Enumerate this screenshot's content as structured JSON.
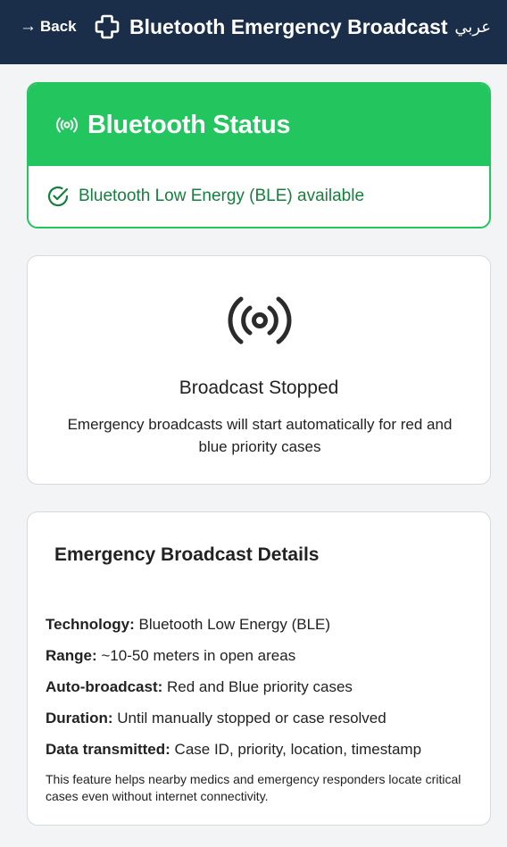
{
  "header": {
    "back_label": "Back",
    "back_arrow": "→",
    "title": "Bluetooth Emergency Broadcast",
    "language_toggle": "عربي",
    "background": "#1a2e4a"
  },
  "bluetooth_status": {
    "title": "Bluetooth Status",
    "status_text": "Bluetooth Low Energy (BLE) available",
    "header_color": "#22c55e",
    "text_color": "#15803d",
    "header_icon": "signal-broadcast-icon",
    "status_icon": "check-circle-icon"
  },
  "broadcast": {
    "icon": "broadcast-icon",
    "status": "Broadcast Stopped",
    "description": "Emergency broadcasts will start automatically for red and blue priority cases"
  },
  "details": {
    "title": "Emergency Broadcast Details",
    "rows": [
      {
        "label": "Technology:",
        "value": "Bluetooth Low Energy (BLE)"
      },
      {
        "label": "Range:",
        "value": "~10-50 meters in open areas"
      },
      {
        "label": "Auto-broadcast:",
        "value": "Red and Blue priority cases"
      },
      {
        "label": "Duration:",
        "value": "Until manually stopped or case resolved"
      },
      {
        "label": "Data transmitted:",
        "value": "Case ID, priority, location, timestamp"
      }
    ],
    "note": "This feature helps nearby medics and emergency responders locate critical cases even without internet connectivity."
  }
}
